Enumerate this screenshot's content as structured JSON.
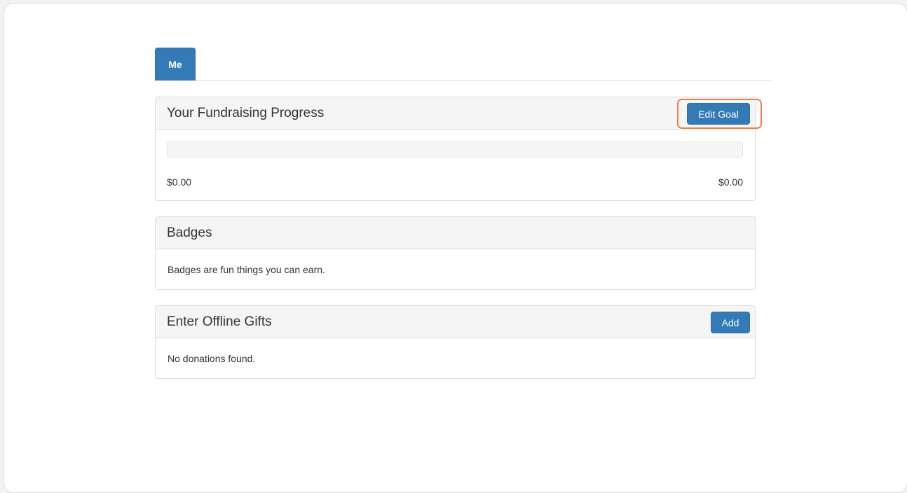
{
  "tabs": [
    {
      "label": "Me",
      "active": true
    }
  ],
  "progress_panel": {
    "title": "Your Fundraising Progress",
    "edit_button": "Edit Goal",
    "progress_fraction": 0,
    "raised_amount": "$0.00",
    "goal_amount": "$0.00"
  },
  "badges_panel": {
    "title": "Badges",
    "description": "Badges are fun things you can earn."
  },
  "offline_gifts_panel": {
    "title": "Enter Offline Gifts",
    "add_button": "Add",
    "empty_message": "No donations found."
  },
  "colors": {
    "primary": "#337ab7",
    "highlight": "#f07d4a",
    "panel_heading_bg": "#f5f5f5"
  }
}
